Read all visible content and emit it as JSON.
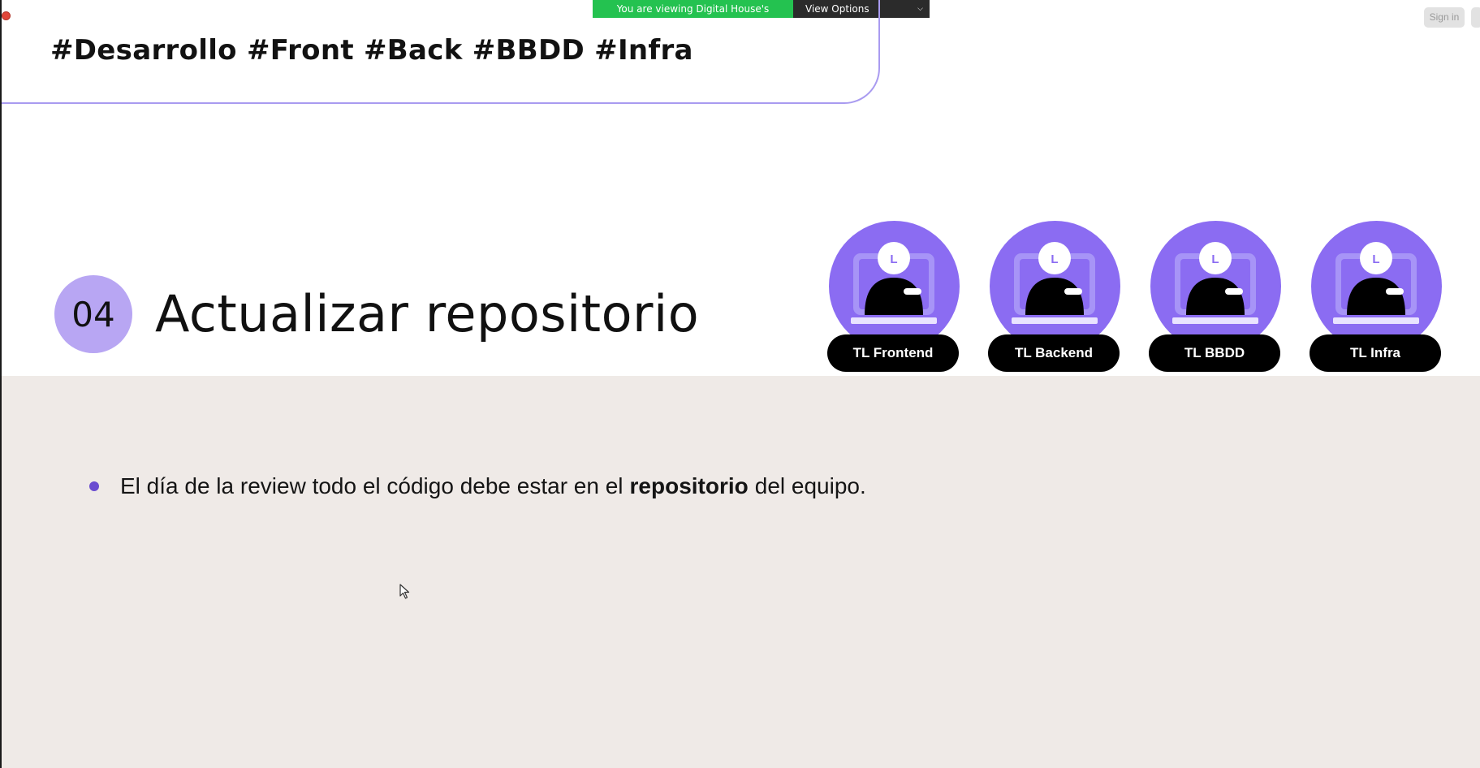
{
  "share_banner": {
    "text": "You are viewing Digital House's screen",
    "view_options": "View Options",
    "bg": "#24c250"
  },
  "top_right": {
    "sign_in": "Sign in"
  },
  "slide": {
    "hashtags": "#Desarrollo #Front #Back #BBDD #Infra",
    "section_number": "04",
    "section_title": "Actualizar repositorio",
    "accent": "#8b6cf2",
    "leads": [
      {
        "label": "TL Frontend",
        "avatar_letter": "L"
      },
      {
        "label": "TL Backend",
        "avatar_letter": "L"
      },
      {
        "label": "TL BBDD",
        "avatar_letter": "L"
      },
      {
        "label": "TL Infra",
        "avatar_letter": "L"
      }
    ],
    "bullet": {
      "before": "El día de la review todo el código debe estar en el",
      "bold": "repositorio",
      "after": "del equipo."
    }
  }
}
